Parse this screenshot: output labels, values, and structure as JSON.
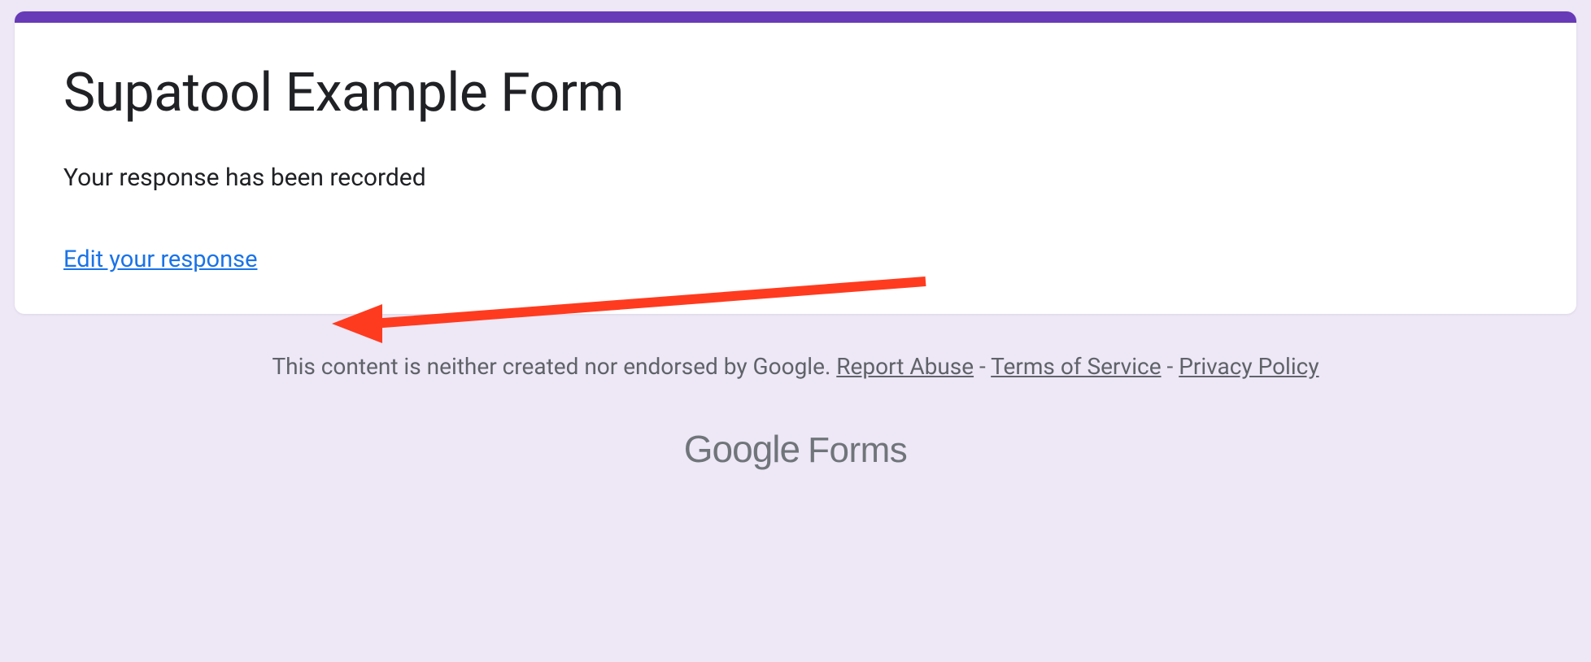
{
  "card": {
    "title": "Supatool Example Form",
    "confirmation": "Your response has been recorded",
    "editLink": "Edit your response"
  },
  "footer": {
    "disclaimer": "This content is neither created nor endorsed by Google. ",
    "reportAbuse": "Report Abuse",
    "termsOfService": "Terms of Service",
    "privacyPolicy": "Privacy Policy",
    "separator": " - "
  },
  "branding": {
    "google": "Google",
    "forms": "Forms"
  },
  "colors": {
    "accent": "#673ab7",
    "background": "#ede7f6",
    "link": "#1a73e8",
    "annotation": "#ff0000"
  }
}
